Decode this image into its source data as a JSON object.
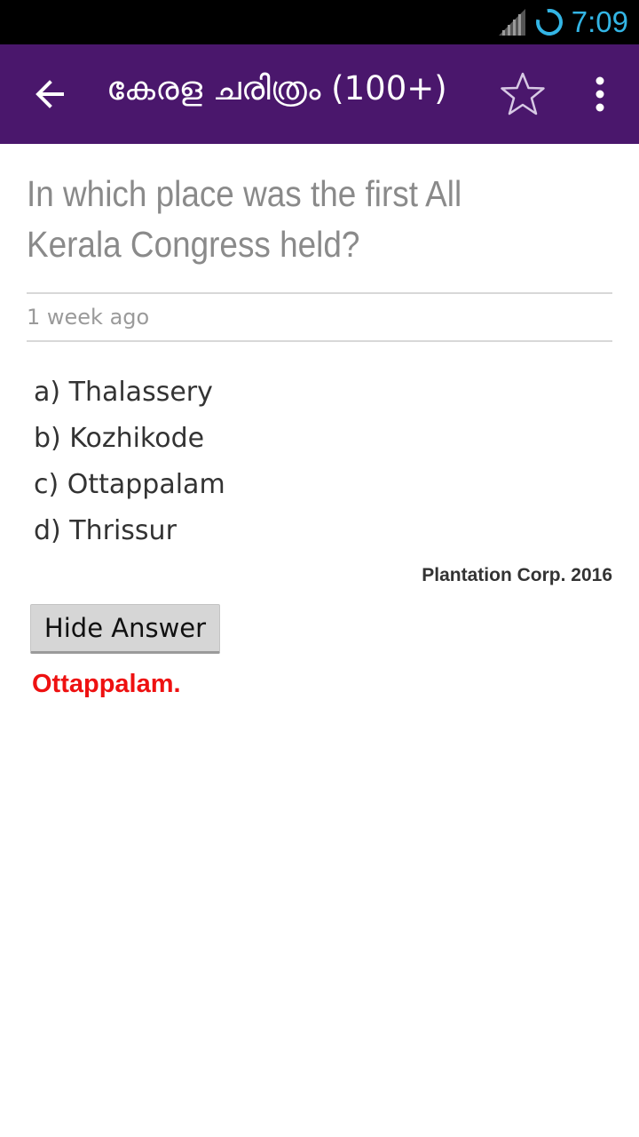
{
  "status_bar": {
    "time": "7:09",
    "icons": [
      "signal-icon",
      "sync-icon"
    ],
    "clock_color": "#33b5e5"
  },
  "app_bar": {
    "title": "കേരള ചരിത്രം (100+)",
    "background": "#4a176c",
    "icons": [
      "back-arrow-icon",
      "star-outline-icon",
      "more-vert-icon"
    ]
  },
  "question": {
    "text": "In which place was the first All Kerala Congress held?",
    "timestamp": "1 week ago"
  },
  "options": [
    {
      "label": "a) Thalassery"
    },
    {
      "label": "b) Kozhikode"
    },
    {
      "label": "c) Ottappalam"
    },
    {
      "label": "d) Thrissur"
    }
  ],
  "source": "Plantation Corp. 2016",
  "hide_answer_label": "Hide Answer",
  "answer": {
    "text": "Ottappalam.",
    "color": "#ee1111"
  }
}
